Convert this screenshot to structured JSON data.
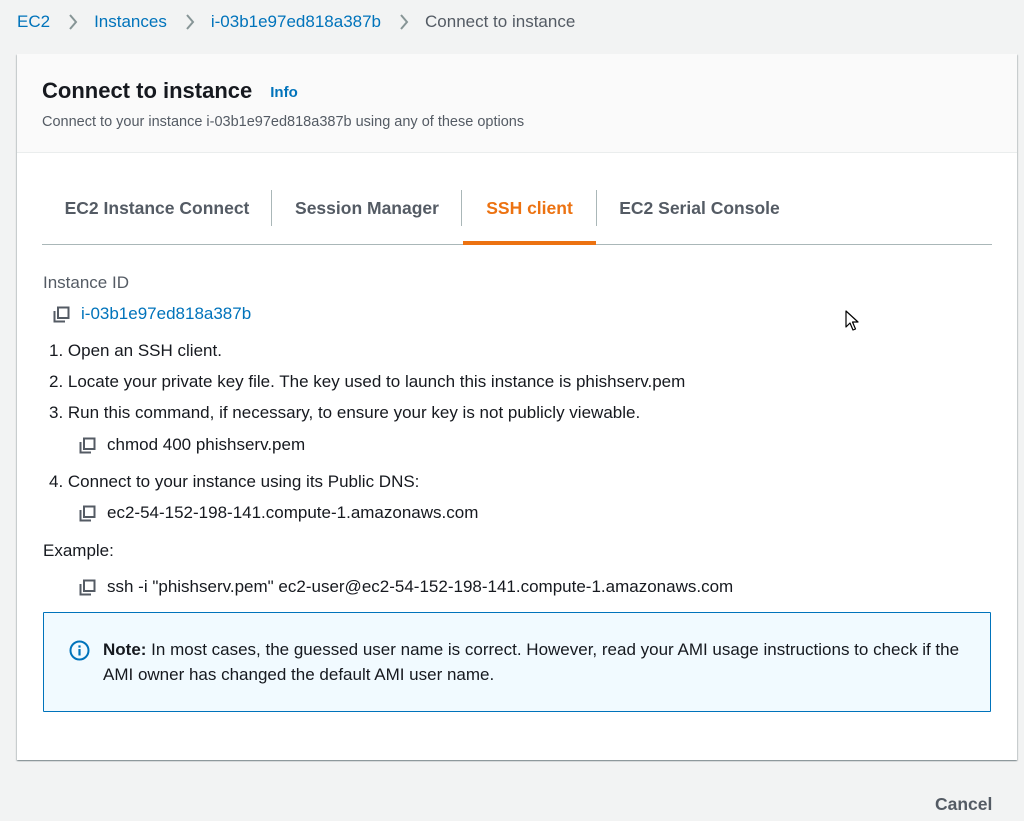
{
  "breadcrumb": {
    "items": [
      "EC2",
      "Instances",
      "i-03b1e97ed818a387b"
    ],
    "current": "Connect to instance"
  },
  "header": {
    "title": "Connect to instance",
    "info_label": "Info",
    "description": "Connect to your instance i-03b1e97ed818a387b using any of these options"
  },
  "tabs": [
    {
      "label": "EC2 Instance Connect",
      "active": false
    },
    {
      "label": "Session Manager",
      "active": false
    },
    {
      "label": "SSH client",
      "active": true
    },
    {
      "label": "EC2 Serial Console",
      "active": false
    }
  ],
  "instance": {
    "label": "Instance ID",
    "id": "i-03b1e97ed818a387b"
  },
  "steps": [
    "1. Open an SSH client.",
    "2. Locate your private key file. The key used to launch this instance is phishserv.pem",
    "3. Run this command, if necessary, to ensure your key is not publicly viewable.",
    "4. Connect to your instance using its Public DNS:"
  ],
  "commands": {
    "chmod": "chmod 400 phishserv.pem",
    "public_dns": "ec2-54-152-198-141.compute-1.amazonaws.com",
    "example_label": "Example:",
    "ssh": "ssh -i \"phishserv.pem\" ec2-user@ec2-54-152-198-141.compute-1.amazonaws.com"
  },
  "note": {
    "bold": "Note:",
    "text": " In most cases, the guessed user name is correct. However, read your AMI usage instructions to check if the AMI owner has changed the default AMI user name."
  },
  "footer": {
    "cancel_label": "Cancel"
  },
  "colors": {
    "link": "#0073bb",
    "active_tab": "#ec7211",
    "note_bg": "#f1faff",
    "note_border": "#0073bb"
  }
}
